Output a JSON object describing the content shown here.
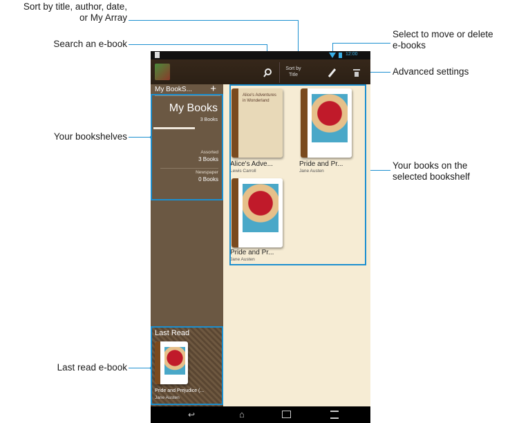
{
  "annotations": {
    "sort": "Sort by title, author, date,",
    "sort2": "or My Array",
    "search": "Search an e-book",
    "select": "Select to move or delete",
    "select2": "e-books",
    "advanced": "Advanced settings",
    "shelves": "Your bookshelves",
    "books": "Your books on the",
    "books2": "selected bookshelf",
    "lastread": "Last read e-book"
  },
  "toolbar": {
    "sort_label_1": "Sort by",
    "sort_label_2": "Title",
    "time": "12:00"
  },
  "sidebar": {
    "header": "My BookS...",
    "add": "+",
    "current_shelf": "My Books",
    "current_count": "3 Books",
    "shelves": [
      {
        "name": "Assorted",
        "count": "3 Books"
      },
      {
        "name": "Newspaper",
        "count": "0 Books"
      }
    ],
    "last_read_title": "Last Read",
    "last_read_book": "Pride and Prejudice (...",
    "last_read_author": "Jane Austen"
  },
  "books": [
    {
      "title": "Alice's Adve...",
      "author": "Lewis Carroll",
      "cover_text": "Alice's Adventures in Wonderland"
    },
    {
      "title": "Pride and Pr...",
      "author": "Jane Austen"
    },
    {
      "title": "Pride and Pr...",
      "author": "Jane Austen"
    }
  ]
}
